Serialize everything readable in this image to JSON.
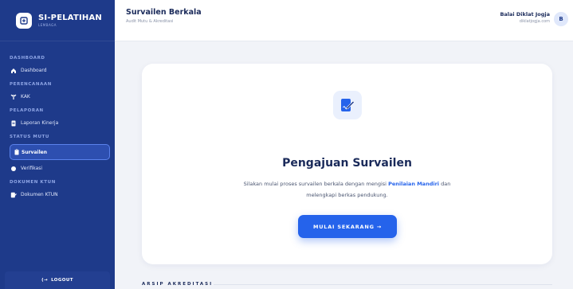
{
  "brand": {
    "title": "SI-PELATIHAN",
    "subtitle": "LEMBAGA"
  },
  "sidebar": {
    "sections": [
      {
        "label": "DASHBOARD",
        "items": [
          {
            "label": "Dashboard",
            "icon": "home-icon"
          }
        ]
      },
      {
        "label": "PERENCANAAN",
        "items": [
          {
            "label": "KAK",
            "icon": "kak-icon"
          }
        ]
      },
      {
        "label": "PELAPORAN",
        "items": [
          {
            "label": "Laporan Kinerja",
            "icon": "document-icon"
          }
        ]
      },
      {
        "label": "STATUS MUTU",
        "items": [
          {
            "label": "Survailen",
            "icon": "clipboard-icon",
            "active": true
          },
          {
            "label": "Verifikasi",
            "icon": "dot-icon"
          }
        ]
      },
      {
        "label": "DOKUMEN KTUN",
        "items": [
          {
            "label": "Dokumen KTUN",
            "icon": "file-edit-icon"
          }
        ]
      }
    ],
    "logout_label": "LOGOUT",
    "logout_icon": "(→"
  },
  "header": {
    "title": "Survailen Berkala",
    "subtitle": "Audit Mutu & Akreditasi",
    "user_name": "Balai Diklat Jogja",
    "user_site": "diklatjogja.com",
    "avatar_initial": "B"
  },
  "card": {
    "icon": "edit-document-icon",
    "title": "Pengajuan Survailen",
    "desc_part1": "Silakan mulai proses survailen berkala dengan mengisi",
    "desc_highlight": "Penilaian Mandiri",
    "desc_part2": "dan melengkapi berkas pendukung.",
    "cta_label": "MULAI SEKARANG →"
  },
  "archive_label": "ARSIP AKREDITASI",
  "colors": {
    "sidebar": "#1e3a8a",
    "accent": "#2563eb",
    "background": "#f1f3f8"
  }
}
